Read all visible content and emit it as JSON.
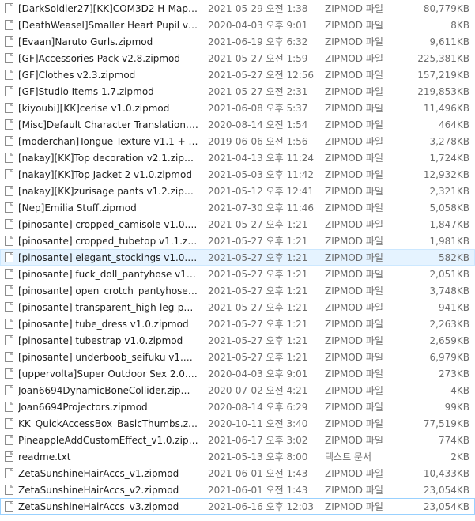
{
  "files": [
    {
      "name": "[DarkSoldier27][KK]COM3D2 H-Maps 1...",
      "date": "2021-05-29 오전 1:38",
      "type": "ZIPMOD 파일",
      "size": "80,779KB",
      "icon": "file-icon"
    },
    {
      "name": "[DeathWeasel]Smaller Heart Pupil v1.1.z...",
      "date": "2020-04-03 오후 9:01",
      "type": "ZIPMOD 파일",
      "size": "8KB",
      "icon": "file-icon"
    },
    {
      "name": "[Evaan]Naruto Gurls.zipmod",
      "date": "2021-06-19 오후 6:32",
      "type": "ZIPMOD 파일",
      "size": "9,611KB",
      "icon": "file-icon"
    },
    {
      "name": "[GF]Accessories Pack v2.8.zipmod",
      "date": "2021-05-27 오전 1:59",
      "type": "ZIPMOD 파일",
      "size": "225,381KB",
      "icon": "file-icon"
    },
    {
      "name": "[GF]Clothes v2.3.zipmod",
      "date": "2021-05-27 오전 12:56",
      "type": "ZIPMOD 파일",
      "size": "157,219KB",
      "icon": "file-icon"
    },
    {
      "name": "[GF]Studio Items 1.7.zipmod",
      "date": "2021-05-27 오전 2:31",
      "type": "ZIPMOD 파일",
      "size": "219,853KB",
      "icon": "file-icon"
    },
    {
      "name": "[kiyoubi][KK]cerise v1.0.zipmod",
      "date": "2021-06-08 오후 5:37",
      "type": "ZIPMOD 파일",
      "size": "11,496KB",
      "icon": "file-icon"
    },
    {
      "name": "[Misc]Default Character Translation.zip...",
      "date": "2020-08-14 오전 1:54",
      "type": "ZIPMOD 파일",
      "size": "464KB",
      "icon": "file-icon"
    },
    {
      "name": "[moderchan]Tongue Texture v1.1 + Out...",
      "date": "2019-06-06 오전 1:56",
      "type": "ZIPMOD 파일",
      "size": "3,278KB",
      "icon": "file-icon"
    },
    {
      "name": "[nakay][KK]Top decoration v2.1.zipmod",
      "date": "2021-04-13 오후 11:24",
      "type": "ZIPMOD 파일",
      "size": "1,724KB",
      "icon": "file-icon"
    },
    {
      "name": "[nakay][KK]Top Jacket 2 v1.0.zipmod",
      "date": "2021-05-03 오후 11:42",
      "type": "ZIPMOD 파일",
      "size": "12,932KB",
      "icon": "file-icon"
    },
    {
      "name": "[nakay][KK]zurisage pants v1.2.zipmod",
      "date": "2021-05-12 오후 12:41",
      "type": "ZIPMOD 파일",
      "size": "2,321KB",
      "icon": "file-icon"
    },
    {
      "name": "[Nep]Emilia Stuff.zipmod",
      "date": "2021-07-30 오후 11:46",
      "type": "ZIPMOD 파일",
      "size": "5,058KB",
      "icon": "file-icon"
    },
    {
      "name": "[pinosante] cropped_camisole v1.0.zipm...",
      "date": "2021-05-27 오후 1:21",
      "type": "ZIPMOD 파일",
      "size": "1,847KB",
      "icon": "file-icon"
    },
    {
      "name": "[pinosante] cropped_tubetop v1.1.zipmod",
      "date": "2021-05-27 오후 1:21",
      "type": "ZIPMOD 파일",
      "size": "1,981KB",
      "icon": "file-icon"
    },
    {
      "name": "[pinosante] elegant_stockings v1.0.zipm...",
      "date": "2021-05-27 오후 1:21",
      "type": "ZIPMOD 파일",
      "size": "582KB",
      "icon": "file-icon",
      "highlighted": true
    },
    {
      "name": "[pinosante] fuck_doll_pantyhose v1.0.zi...",
      "date": "2021-05-27 오후 1:21",
      "type": "ZIPMOD 파일",
      "size": "2,051KB",
      "icon": "file-icon"
    },
    {
      "name": "[pinosante] open_crotch_pantyhose v1.0...",
      "date": "2021-05-27 오후 1:21",
      "type": "ZIPMOD 파일",
      "size": "3,748KB",
      "icon": "file-icon"
    },
    {
      "name": "[pinosante] transparent_high-leg-panties...",
      "date": "2021-05-27 오후 1:21",
      "type": "ZIPMOD 파일",
      "size": "941KB",
      "icon": "file-icon"
    },
    {
      "name": "[pinosante] tube_dress v1.0.zipmod",
      "date": "2021-05-27 오후 1:21",
      "type": "ZIPMOD 파일",
      "size": "2,263KB",
      "icon": "file-icon"
    },
    {
      "name": "[pinosante] tubestrap v1.0.zipmod",
      "date": "2021-05-27 오후 1:21",
      "type": "ZIPMOD 파일",
      "size": "2,659KB",
      "icon": "file-icon"
    },
    {
      "name": "[pinosante] underboob_seifuku v1.1.zip...",
      "date": "2021-05-27 오후 1:21",
      "type": "ZIPMOD 파일",
      "size": "6,979KB",
      "icon": "file-icon"
    },
    {
      "name": "[uppervolta]Super Outdoor Sex 2.0.zip...",
      "date": "2020-04-03 오후 9:01",
      "type": "ZIPMOD 파일",
      "size": "273KB",
      "icon": "file-icon"
    },
    {
      "name": "Joan6694DynamicBoneCollider.zipmod",
      "date": "2020-07-02 오전 4:21",
      "type": "ZIPMOD 파일",
      "size": "4KB",
      "icon": "file-icon"
    },
    {
      "name": "Joan6694Projectors.zipmod",
      "date": "2020-08-14 오후 6:29",
      "type": "ZIPMOD 파일",
      "size": "99KB",
      "icon": "file-icon"
    },
    {
      "name": "KK_QuickAccessBox_BasicThumbs.zipmod",
      "date": "2020-10-11 오전 3:40",
      "type": "ZIPMOD 파일",
      "size": "77,519KB",
      "icon": "file-icon"
    },
    {
      "name": "PineappleAddCustomEffect_v1.0.zipmod",
      "date": "2021-06-17 오후 3:02",
      "type": "ZIPMOD 파일",
      "size": "774KB",
      "icon": "file-icon"
    },
    {
      "name": "readme.txt",
      "date": "2021-05-13 오후 8:00",
      "type": "텍스트 문서",
      "size": "2KB",
      "icon": "text-file-icon"
    },
    {
      "name": "ZetaSunshineHairAccs_v1.zipmod",
      "date": "2021-06-01 오전 1:43",
      "type": "ZIPMOD 파일",
      "size": "10,433KB",
      "icon": "file-icon"
    },
    {
      "name": "ZetaSunshineHairAccs_v2.zipmod",
      "date": "2021-06-01 오전 1:43",
      "type": "ZIPMOD 파일",
      "size": "23,054KB",
      "icon": "file-icon"
    },
    {
      "name": "ZetaSunshineHairAccs_v3.zipmod",
      "date": "2021-06-16 오후 12:03",
      "type": "ZIPMOD 파일",
      "size": "23,054KB",
      "icon": "file-icon",
      "focused": true
    }
  ]
}
